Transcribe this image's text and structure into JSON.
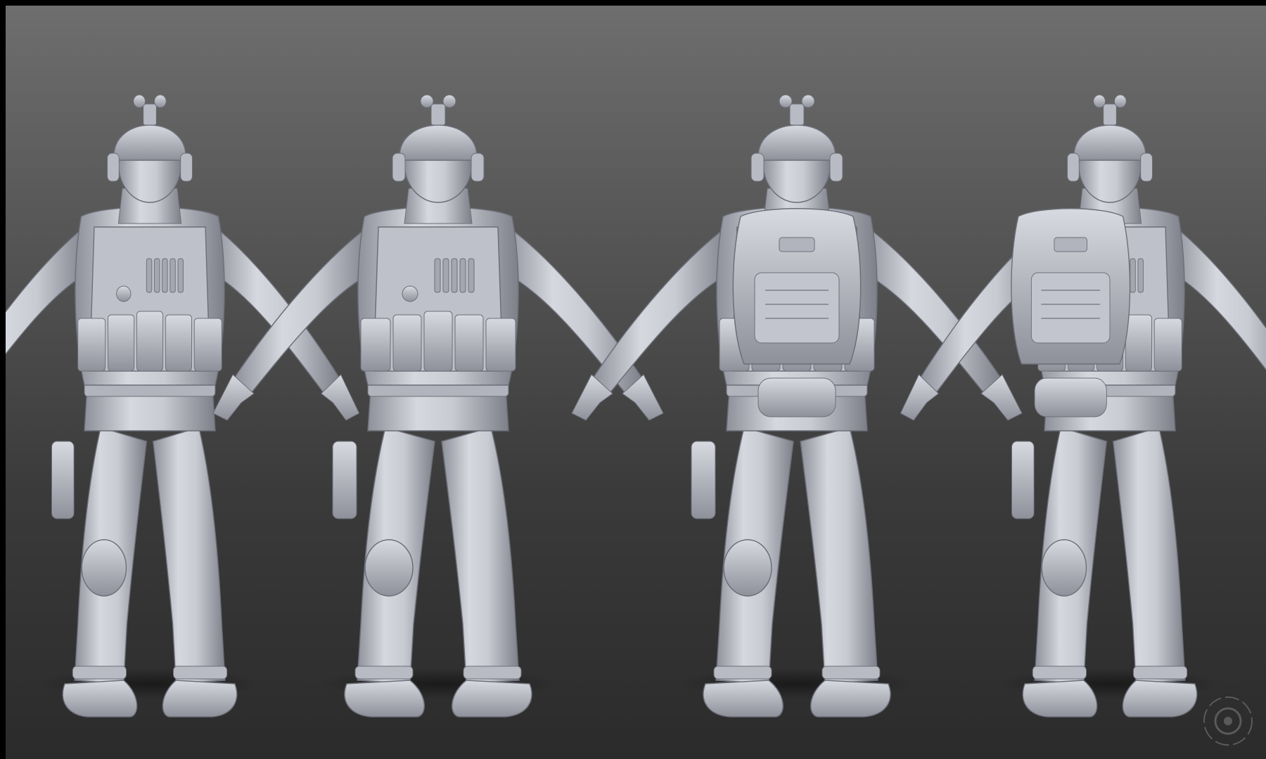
{
  "scene": {
    "subject": "soldier-3d-sculpt-turnaround",
    "views": [
      {
        "id": "three-quarter-front-left"
      },
      {
        "id": "front"
      },
      {
        "id": "back"
      },
      {
        "id": "three-quarter-back-right"
      }
    ],
    "colors": {
      "background_top": "#6e6e6e",
      "background_bottom": "#2b2b2b",
      "clay": "#c9cbd3",
      "clay_shadow": "#8e909a",
      "clay_dark": "#6c6e78",
      "frame": "#000000"
    }
  },
  "watermark": {
    "icon": "concentric-circles-logo-icon"
  }
}
